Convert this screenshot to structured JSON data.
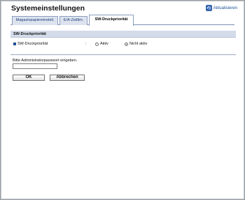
{
  "header": {
    "title": "Systemeinstellungen",
    "refresh_label": "Aktualisieren"
  },
  "tabs": [
    {
      "label": "Magazinpapiereinstell."
    },
    {
      "label": "E/A-Zeitlim."
    },
    {
      "label": "SW-Druckpriorität",
      "active": true
    }
  ],
  "section": {
    "title": "SW-Druckpriorität",
    "setting_label": "SW-Druckpriorität",
    "colon": ":",
    "options": [
      {
        "label": "Aktiv",
        "selected": false
      },
      {
        "label": "Nicht aktiv",
        "selected": true
      }
    ]
  },
  "password": {
    "label": "Bitte Administratorpasswort eingeben.",
    "value": ""
  },
  "buttons": {
    "ok": "OK",
    "cancel": "Abbrechen"
  }
}
